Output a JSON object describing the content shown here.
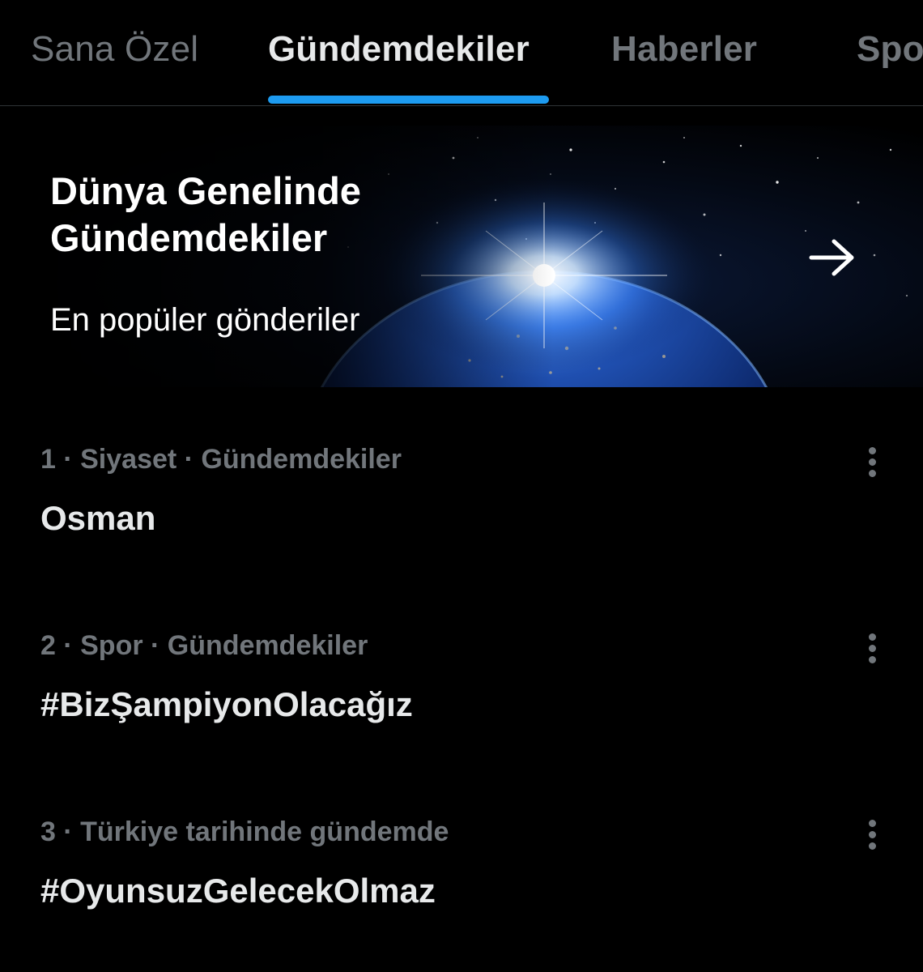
{
  "tabs": [
    {
      "label": "Sana Özel",
      "active": false
    },
    {
      "label": "Gündemdekiler",
      "active": true
    },
    {
      "label": "Haberler",
      "active": false
    },
    {
      "label": "Spor",
      "active": false
    }
  ],
  "banner": {
    "title_line1": "Dünya Genelinde",
    "title_line2": "Gündemdekiler",
    "subtitle": "En popüler gönderiler",
    "arrow_icon": "arrow-right-icon",
    "image": "earth-from-space"
  },
  "trends": [
    {
      "meta": "1 · Siyaset · Gündemdekiler",
      "name": "Osman"
    },
    {
      "meta": "2 · Spor · Gündemdekiler",
      "name": "#BizŞampiyonOlacağız"
    },
    {
      "meta": "3 · Türkiye tarihinde gündemde",
      "name": "#OyunsuzGelecekOlmaz"
    }
  ],
  "colors": {
    "background": "#000000",
    "accent": "#1d9bf0",
    "text_primary": "#e7e9ea",
    "text_secondary": "#71767b",
    "divider": "#2f3336"
  }
}
